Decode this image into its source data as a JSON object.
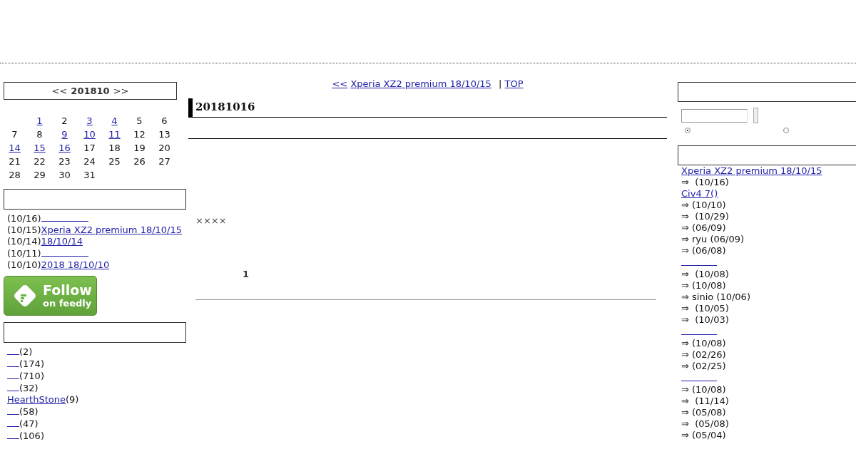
{
  "calendar": {
    "prev": "<<",
    "month": "201810",
    "next": ">>",
    "days": [
      {
        "day": "1",
        "linked": true
      },
      {
        "day": "2",
        "linked": false
      },
      {
        "day": "3",
        "linked": true
      },
      {
        "day": "4",
        "linked": true
      },
      {
        "day": "5",
        "linked": false
      },
      {
        "day": "6",
        "linked": false
      },
      {
        "day": "7",
        "linked": false
      },
      {
        "day": "8",
        "linked": false
      },
      {
        "day": "9",
        "linked": true
      },
      {
        "day": "10",
        "linked": true
      },
      {
        "day": "11",
        "linked": true
      },
      {
        "day": "12",
        "linked": false
      },
      {
        "day": "13",
        "linked": false
      },
      {
        "day": "14",
        "linked": true
      },
      {
        "day": "15",
        "linked": true
      },
      {
        "day": "16",
        "linked": true
      },
      {
        "day": "17",
        "linked": false
      },
      {
        "day": "18",
        "linked": false
      },
      {
        "day": "19",
        "linked": false
      },
      {
        "day": "20",
        "linked": false
      },
      {
        "day": "21",
        "linked": false
      },
      {
        "day": "22",
        "linked": false
      },
      {
        "day": "23",
        "linked": false
      },
      {
        "day": "24",
        "linked": false
      },
      {
        "day": "25",
        "linked": false
      },
      {
        "day": "26",
        "linked": false
      },
      {
        "day": "27",
        "linked": false
      },
      {
        "day": "28",
        "linked": false
      },
      {
        "day": "29",
        "linked": false
      },
      {
        "day": "30",
        "linked": false
      },
      {
        "day": "31",
        "linked": false
      }
    ]
  },
  "recent_posts": [
    {
      "date": "(10/16)"
    },
    {
      "date": "(10/15)",
      "title": "Xperia XZ2 premium 18/10/15"
    },
    {
      "date": "(10/14)",
      "title": "18/10/14"
    },
    {
      "date": "(10/11)"
    },
    {
      "date": "(10/10)",
      "title": "2018 18/10/10"
    }
  ],
  "feedly": {
    "line1": "Follow",
    "line2": "on feedly"
  },
  "categories": [
    {
      "count": "(2)"
    },
    {
      "count": "(174)"
    },
    {
      "count": "(710)"
    },
    {
      "count": "(32)"
    },
    {
      "name": "HearthStone",
      "count": "(9)"
    },
    {
      "count": "(58)"
    },
    {
      "count": "(47)"
    },
    {
      "count": "(106)"
    }
  ],
  "nav": {
    "prev": "<<",
    "prev_title": "Xperia XZ2 premium 18/10/15",
    "separator": "|",
    "top": "TOP"
  },
  "entry": {
    "date": "20181016",
    "marks": "××××",
    "page": "1"
  },
  "search": {
    "options": [
      {
        "selected": true
      },
      {
        "selected": false
      }
    ]
  },
  "comments": [
    {
      "title": "Xperia XZ2 premium 18/10/15",
      "rows": [
        "⇒  (10/16)"
      ]
    },
    {
      "title": "Civ4 7()",
      "rows": [
        "⇒ (10/10)",
        "⇒  (10/29)",
        "⇒ (06/09)",
        "⇒ ryu (06/09)",
        "⇒ (06/08)"
      ]
    },
    {
      "rows": [
        "⇒  (10/08)",
        "⇒ (10/08)",
        "⇒ sinio (10/06)",
        "⇒  (10/05)",
        "⇒  (10/03)"
      ]
    },
    {
      "rows": [
        "⇒ (10/08)",
        "⇒ (02/26)",
        "⇒ (02/25)"
      ]
    },
    {
      "rows": [
        "⇒ (10/08)",
        "⇒  (11/14)",
        "⇒ (05/08)",
        "⇒  (05/08)",
        "⇒ (05/04)"
      ]
    }
  ]
}
